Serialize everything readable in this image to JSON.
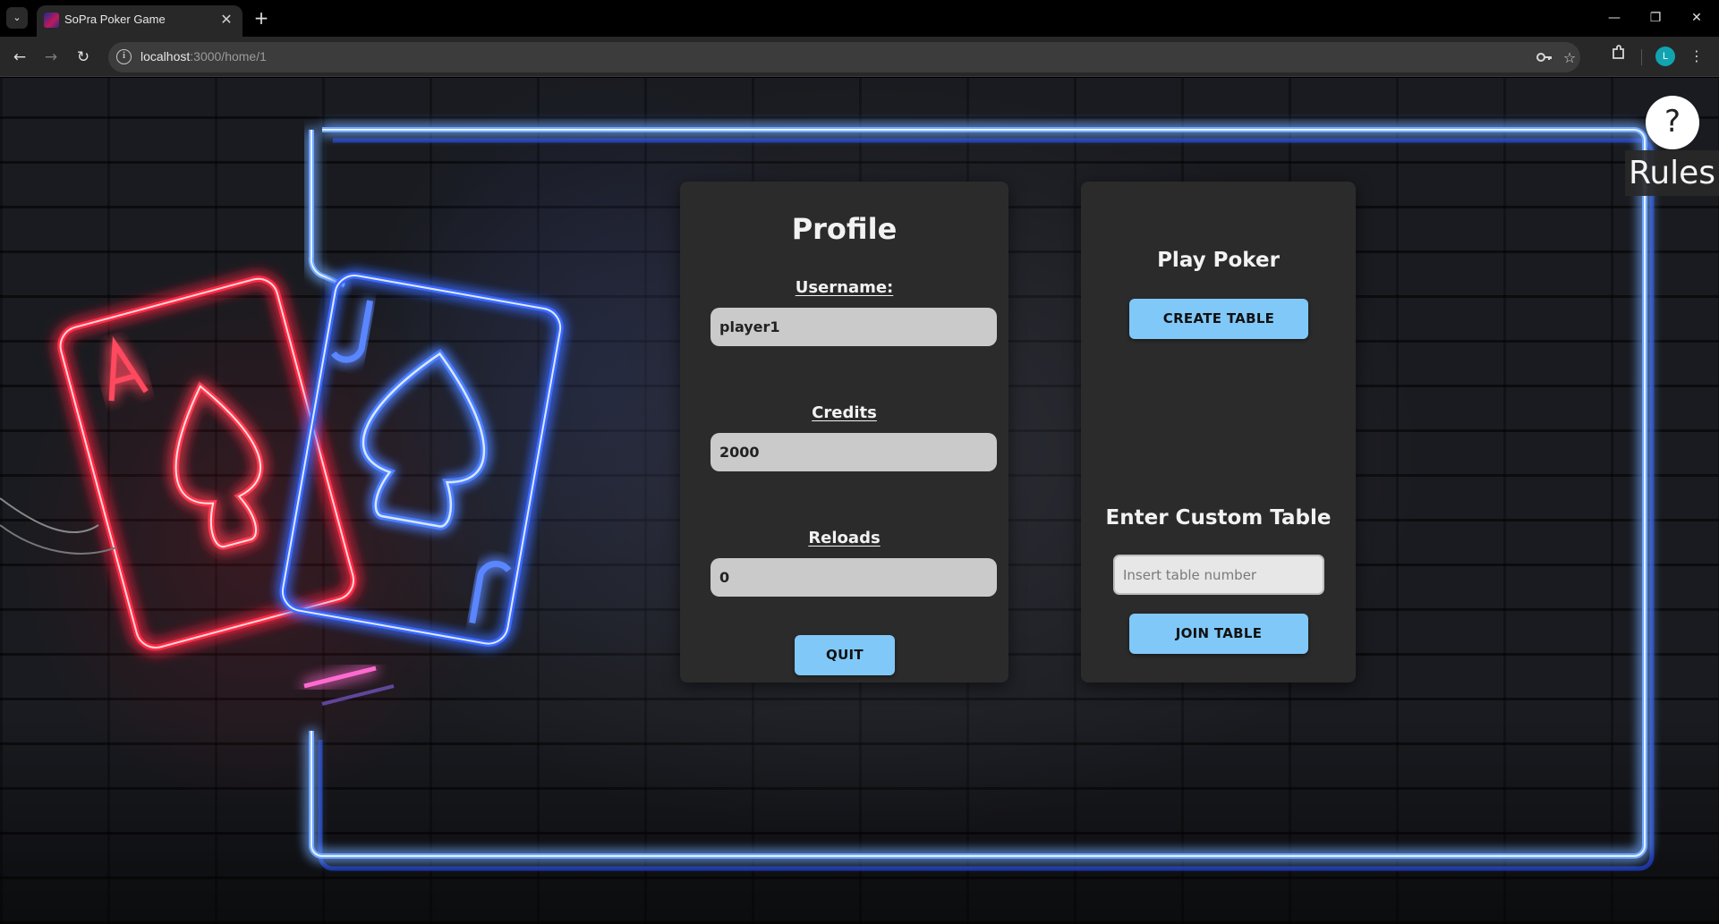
{
  "browser": {
    "tab_title": "SoPra Poker Game",
    "tab_close_glyph": "✕",
    "new_tab_glyph": "+",
    "tab_menu_glyph": "⌄",
    "url_host": "localhost",
    "url_path": ":3000/home/1",
    "window_controls": {
      "minimize": "—",
      "restore": "❐",
      "close": "✕"
    },
    "nav": {
      "back": "←",
      "forward": "→",
      "reload": "↻"
    },
    "avatar_letter": "L",
    "icons": [
      "info-icon",
      "password-key-icon",
      "bookmark-star-icon",
      "extensions-icon",
      "kebab-menu-icon"
    ]
  },
  "profile": {
    "title": "Profile",
    "username_label": "Username:",
    "username_value": "player1",
    "credits_label": "Credits",
    "credits_value": "2000",
    "reloads_label": "Reloads",
    "reloads_value": "0",
    "quit_label": "QUIT"
  },
  "play": {
    "title": "Play Poker",
    "create_label": "CREATE TABLE",
    "custom_title": "Enter Custom Table",
    "table_placeholder": "Insert table number",
    "join_label": "JOIN TABLE"
  },
  "rules": {
    "icon_glyph": "?",
    "label": "Rules"
  },
  "colors": {
    "button": "#80c8f8",
    "card_bg": "#2b2b2b",
    "input_bg": "#c9cac9",
    "neon_blue": "#3a6bff",
    "neon_red": "#ff2a44"
  }
}
